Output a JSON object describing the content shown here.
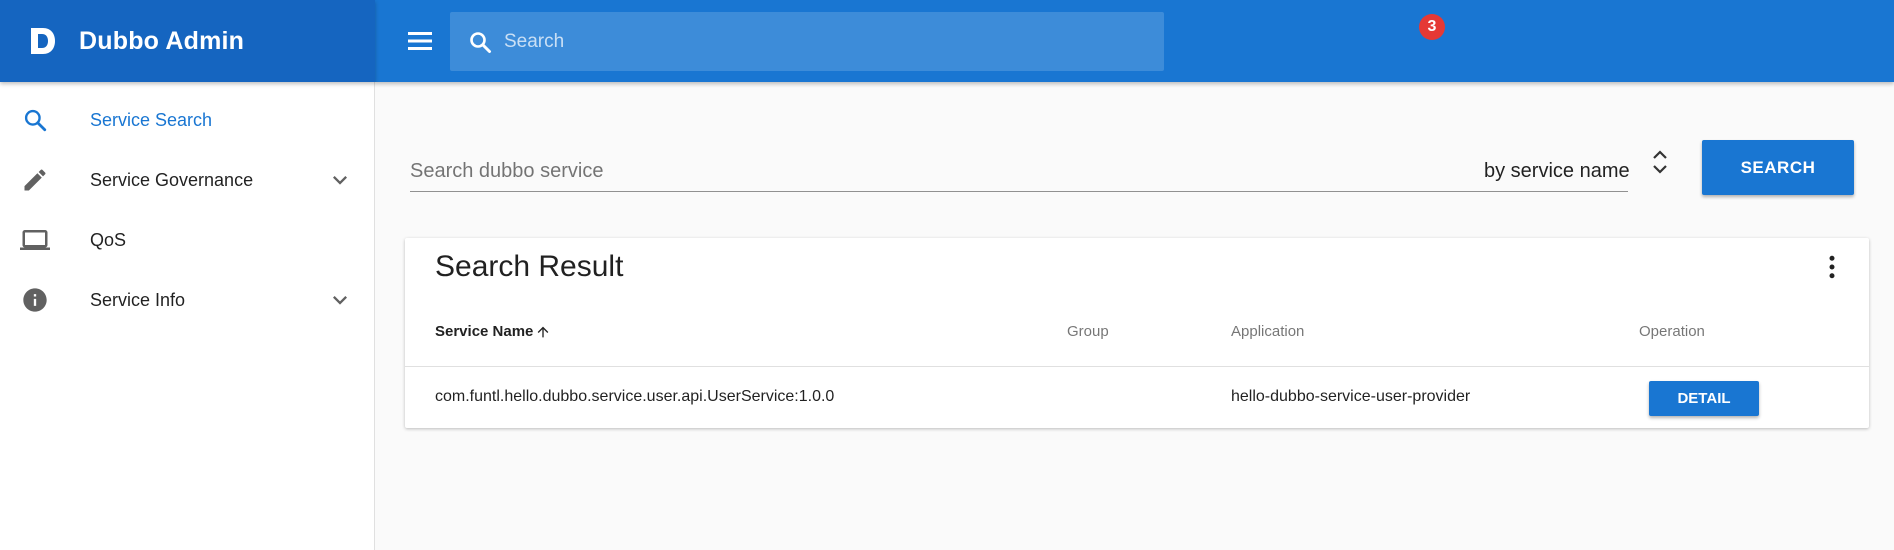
{
  "app": {
    "title": "Dubbo Admin"
  },
  "header": {
    "search_placeholder": "Search",
    "notification_count": "3"
  },
  "sidebar": {
    "items": [
      {
        "label": "Service Search",
        "icon": "search-icon",
        "active": true,
        "expandable": false
      },
      {
        "label": "Service Governance",
        "icon": "pencil-icon",
        "active": false,
        "expandable": true
      },
      {
        "label": "QoS",
        "icon": "laptop-icon",
        "active": false,
        "expandable": false
      },
      {
        "label": "Service Info",
        "icon": "info-icon",
        "active": false,
        "expandable": true
      }
    ]
  },
  "search": {
    "placeholder": "Search dubbo service",
    "by_value": "by service name",
    "button_label": "SEARCH"
  },
  "results": {
    "title": "Search Result",
    "columns": [
      "Service Name",
      "Group",
      "Application",
      "Operation"
    ],
    "rows": [
      {
        "service_name": "com.funtl.hello.dubbo.service.user.api.UserService:1.0.0",
        "group": "",
        "application": "hello-dubbo-service-user-provider",
        "operation_label": "DETAIL"
      }
    ]
  },
  "colors": {
    "brand": "#1565c0",
    "header": "#1976d2",
    "accent": "#1976d2",
    "badge": "#e53935"
  }
}
